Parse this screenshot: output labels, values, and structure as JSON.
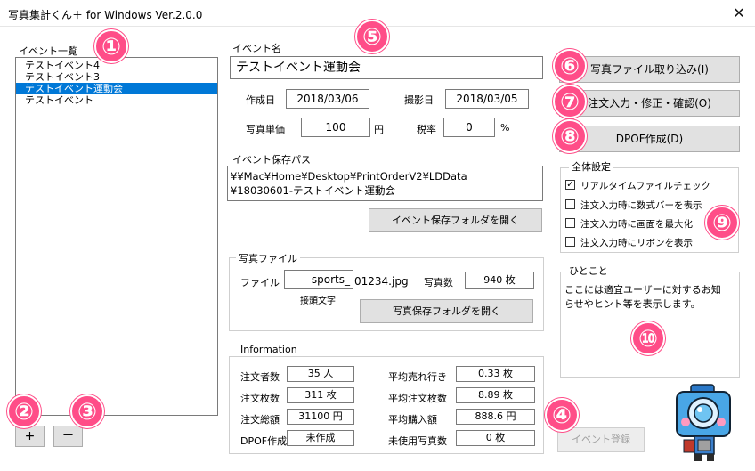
{
  "window": {
    "title": "写真集計くん＋ for Windows Ver.2.0.0",
    "close": "✕"
  },
  "events": {
    "label": "イベント一覧",
    "items": [
      "テストイベント4",
      "テストイベント3",
      "テストイベント運動会",
      "テストイベント"
    ],
    "selected_index": 2,
    "add_label": "+",
    "remove_label": "－"
  },
  "event": {
    "name_label": "イベント名",
    "name": "テストイベント運動会",
    "created_label": "作成日",
    "created": "2018/03/06",
    "shot_label": "撮影日",
    "shot": "2018/03/05",
    "price_label": "写真単価",
    "price": "100",
    "price_unit": "円",
    "tax_label": "税率",
    "tax": "0",
    "tax_unit": "%",
    "path_label": "イベント保存パス",
    "path_line1": "¥¥Mac¥Home¥Desktop¥PrintOrderV2¥LDData",
    "path_line2": "¥18030601-テストイベント運動会",
    "open_folder_btn": "イベント保存フォルダを開く"
  },
  "photo_file": {
    "group_label": "写真ファイル",
    "file_label": "ファイル",
    "prefix": "sports_",
    "suffix": "01234.jpg",
    "prefix_caption": "接頭文字",
    "count_label": "写真数",
    "count": "940 枚",
    "open_btn": "写真保存フォルダを開く"
  },
  "info": {
    "group_label": "Information",
    "rows": [
      {
        "l1": "注文者数",
        "v1": "35 人",
        "l2": "平均売れ行き",
        "v2": "0.33 枚"
      },
      {
        "l1": "注文枚数",
        "v1": "311 枚",
        "l2": "平均注文枚数",
        "v2": "8.89 枚"
      },
      {
        "l1": "注文総額",
        "v1": "31100 円",
        "l2": "平均購入額",
        "v2": "888.6 円"
      },
      {
        "l1": "DPOF作成",
        "v1": "未作成",
        "l2": "未使用写真数",
        "v2": "0 枚"
      }
    ]
  },
  "actions": {
    "import": "写真ファイル取り込み(I)",
    "order": "注文入力・修正・確認(O)",
    "dpof": "DPOF作成(D)",
    "register": "イベント登録"
  },
  "settings": {
    "group_label": "全体設定",
    "items": [
      {
        "label": "リアルタイムファイルチェック",
        "checked": true
      },
      {
        "label": "注文入力時に数式バーを表示",
        "checked": false
      },
      {
        "label": "注文入力時に画面を最大化",
        "checked": false
      },
      {
        "label": "注文入力時にリボンを表示",
        "checked": false
      }
    ]
  },
  "hint": {
    "group_label": "ひとこと",
    "line1": "ここには適宜ユーザーに対するお知",
    "line2": "らせやヒント等を表示します。"
  },
  "badges": [
    "①",
    "②",
    "③",
    "④",
    "⑤",
    "⑥",
    "⑦",
    "⑧",
    "⑨",
    "⑩"
  ],
  "colors": {
    "selection": "#0078d7",
    "badge": "#ff4d88"
  }
}
